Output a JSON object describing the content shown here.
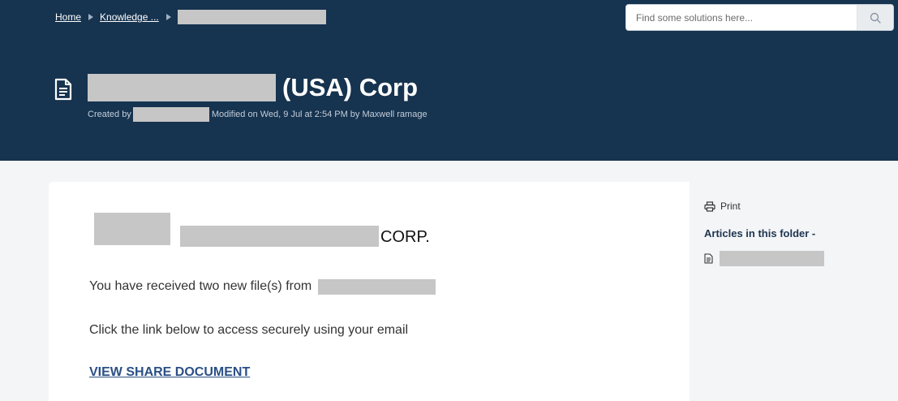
{
  "breadcrumb": {
    "home": "Home",
    "knowledge": "Knowledge ..."
  },
  "search": {
    "placeholder": "Find some solutions here..."
  },
  "article": {
    "title_suffix": "(USA) Corp",
    "created_by_label": "Created by",
    "modified_text": "Modified on Wed, 9 Jul at 2:54 PM by Maxwell ramage"
  },
  "body": {
    "corp_text": "CORP.",
    "received_text": "You have received two new file(s) from",
    "instruction_text": "Click the link below to access securely using your email",
    "link_text": "VIEW SHARE DOCUMENT"
  },
  "sidebar": {
    "print_label": "Print",
    "folder_heading": "Articles in this folder -"
  },
  "icons": {
    "breadcrumb_separator": "caret-right-icon",
    "search": "search-icon",
    "article": "document-icon",
    "print": "printer-icon"
  },
  "colors": {
    "header_bg": "#16334f",
    "page_bg": "#f4f5f7",
    "link": "#2a4f86",
    "redaction": "#c6c6c6"
  }
}
